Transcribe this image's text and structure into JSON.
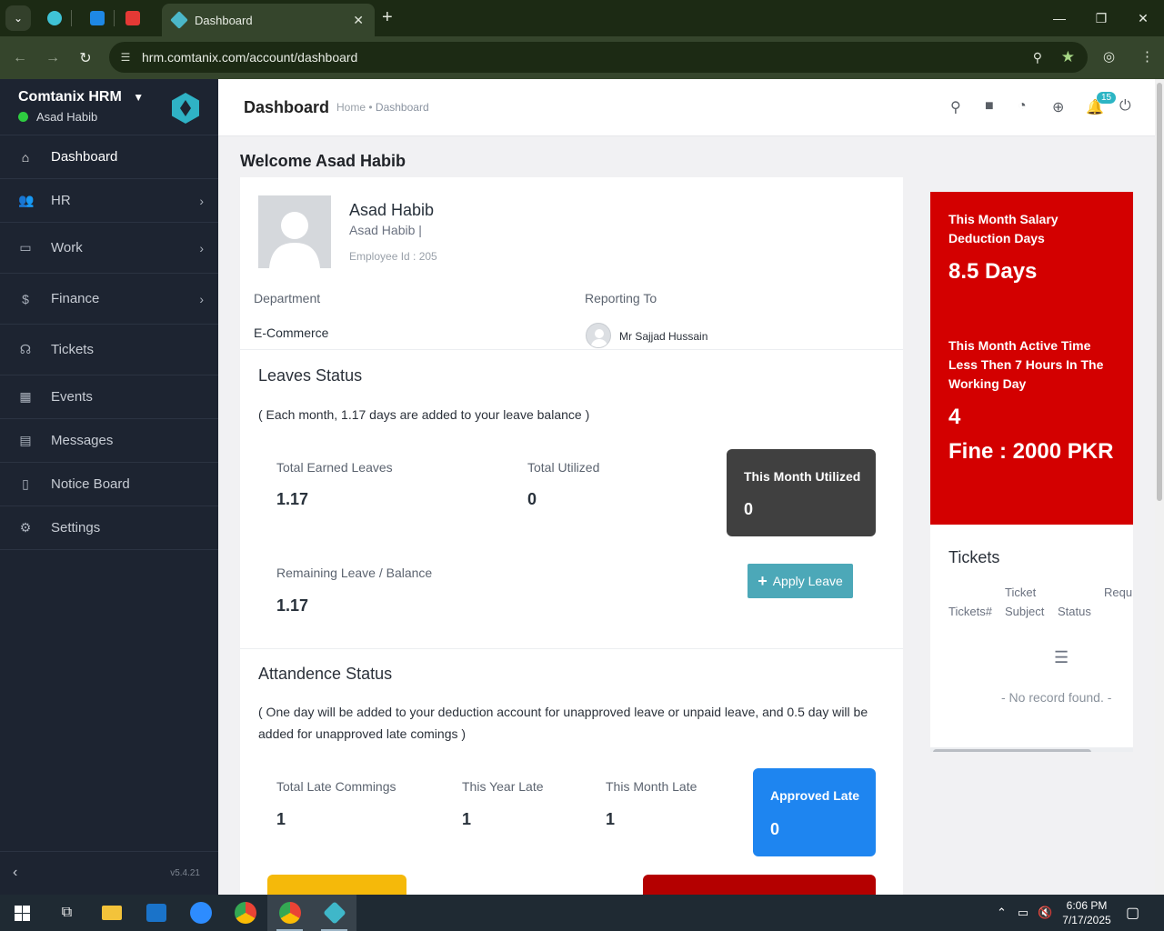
{
  "browser": {
    "tab_title": "Dashboard",
    "url": "hrm.comtanix.com/account/dashboard"
  },
  "sidebar": {
    "brand": "Comtanix HRM",
    "user": "Asad Habib",
    "version": "v5.4.21",
    "items": [
      {
        "label": "Dashboard",
        "icon": "home-icon"
      },
      {
        "label": "HR",
        "icon": "users-icon"
      },
      {
        "label": "Work",
        "icon": "briefcase-icon"
      },
      {
        "label": "Finance",
        "icon": "dollar-icon"
      },
      {
        "label": "Tickets",
        "icon": "headset-icon"
      },
      {
        "label": "Events",
        "icon": "calendar-icon"
      },
      {
        "label": "Messages",
        "icon": "message-icon"
      },
      {
        "label": "Notice Board",
        "icon": "clipboard-icon"
      },
      {
        "label": "Settings",
        "icon": "gear-icon"
      }
    ]
  },
  "header": {
    "title": "Dashboard",
    "breadcrumb_home": "Home",
    "breadcrumb_sep": "•",
    "breadcrumb_current": "Dashboard",
    "notification_count": "15"
  },
  "welcome": "Welcome Asad Habib",
  "profile": {
    "name": "Asad Habib",
    "subtitle": "Asad Habib |",
    "employee_id": "Employee Id : 205",
    "department_label": "Department",
    "department": "E-Commerce",
    "reporting_label": "Reporting To",
    "reporting_to": "Mr Sajjad Hussain"
  },
  "leaves": {
    "title": "Leaves Status",
    "note": "( Each month, 1.17 days are added to your leave balance )",
    "earned_label": "Total Earned Leaves",
    "earned": "1.17",
    "utilized_label": "Total Utilized",
    "utilized": "0",
    "month_label": "This Month Utilized",
    "month": "0",
    "remaining_label": "Remaining Leave / Balance",
    "remaining": "1.17",
    "apply_label": "Apply Leave"
  },
  "attendance": {
    "title": "Attandence Status",
    "note": "( One day will be added to your deduction account for unapproved leave or unpaid leave, and 0.5 day will be added for unapproved late comings )",
    "late_total_label": "Total Late Commings",
    "late_total": "1",
    "year_late_label": "This Year Late",
    "year_late": "1",
    "month_late_label": "This Month Late",
    "month_late": "1",
    "approved_label": "Approved Late",
    "approved": "0"
  },
  "deduction": {
    "salary_label": "This Month Salary Deduction Days",
    "salary_value": "8.5 Days",
    "active_label": "This Month Active Time Less Then 7 Hours In The Working Day",
    "active_value": "4",
    "fine": "Fine : 2000 PKR"
  },
  "tickets": {
    "title": "Tickets",
    "col_num": "Tickets#",
    "col_subject_1": "Ticket",
    "col_subject_2": "Subject",
    "col_status": "Status",
    "col_req": "Requ",
    "empty": "- No record found. -"
  },
  "taskbar": {
    "time": "6:06 PM",
    "date": "7/17/2025"
  },
  "colors": {
    "sidebar": "#1d2431",
    "deduction_red": "#d30000",
    "approved_blue": "#1e85f0",
    "dark_box": "#404040",
    "apply_teal": "#4ca8b8"
  }
}
